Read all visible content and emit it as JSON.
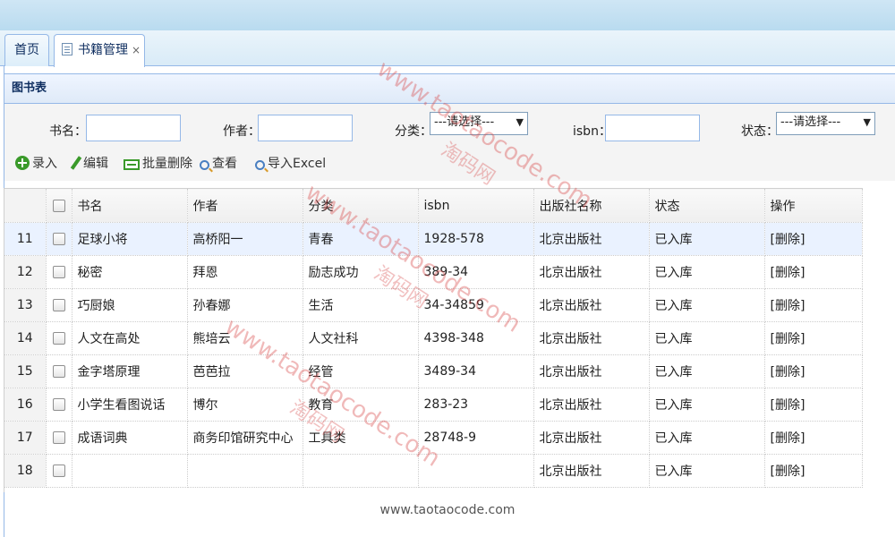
{
  "tabs": [
    {
      "label": "首页"
    },
    {
      "label": "书籍管理",
      "close": "×"
    }
  ],
  "panel": {
    "title": "图书表"
  },
  "search": {
    "name_label": "书名：",
    "author_label": "作者：",
    "category_label": "分类：",
    "category_value": "---请选择---",
    "isbn_label": "isbn：",
    "status_label": "状态：",
    "status_value": "---请选择---",
    "select_arrow": "▼"
  },
  "toolbar": {
    "add": "录入",
    "edit": "编辑",
    "batch_delete": "批量删除",
    "view": "查看",
    "import": "导入Excel"
  },
  "table": {
    "headers": [
      "书名",
      "作者",
      "分类",
      "isbn",
      "出版社名称",
      "状态",
      "操作"
    ],
    "rows": [
      {
        "n": "11",
        "name": "足球小将",
        "author": "高桥阳一",
        "category": "青春",
        "isbn": "1928-578",
        "publisher": "北京出版社",
        "status": "已入库",
        "op": "[删除]"
      },
      {
        "n": "12",
        "name": "秘密",
        "author": "拜恩",
        "category": "励志成功",
        "isbn": "389-34",
        "publisher": "北京出版社",
        "status": "已入库",
        "op": "[删除]"
      },
      {
        "n": "13",
        "name": "巧厨娘",
        "author": "孙春娜",
        "category": "生活",
        "isbn": "34-34859",
        "publisher": "北京出版社",
        "status": "已入库",
        "op": "[删除]"
      },
      {
        "n": "14",
        "name": "人文在高处",
        "author": "熊培云",
        "category": "人文社科",
        "isbn": "4398-348",
        "publisher": "北京出版社",
        "status": "已入库",
        "op": "[删除]"
      },
      {
        "n": "15",
        "name": "金字塔原理",
        "author": "芭芭拉",
        "category": "经管",
        "isbn": "3489-34",
        "publisher": "北京出版社",
        "status": "已入库",
        "op": "[删除]"
      },
      {
        "n": "16",
        "name": "小学生看图说话",
        "author": "博尔",
        "category": "教育",
        "isbn": "283-23",
        "publisher": "北京出版社",
        "status": "已入库",
        "op": "[删除]"
      },
      {
        "n": "17",
        "name": "成语词典",
        "author": "商务印馆研究中心",
        "category": "工具类",
        "isbn": "28748-9",
        "publisher": "北京出版社",
        "status": "已入库",
        "op": "[删除]"
      },
      {
        "n": "18",
        "name": "",
        "author": "",
        "category": "",
        "isbn": "",
        "publisher": "北京出版社",
        "status": "已入库",
        "op": "[删除]"
      }
    ]
  },
  "watermark": {
    "url": "www.taotaocode.com",
    "cn": "淘码网",
    "footer": "www.taotaocode.com"
  }
}
